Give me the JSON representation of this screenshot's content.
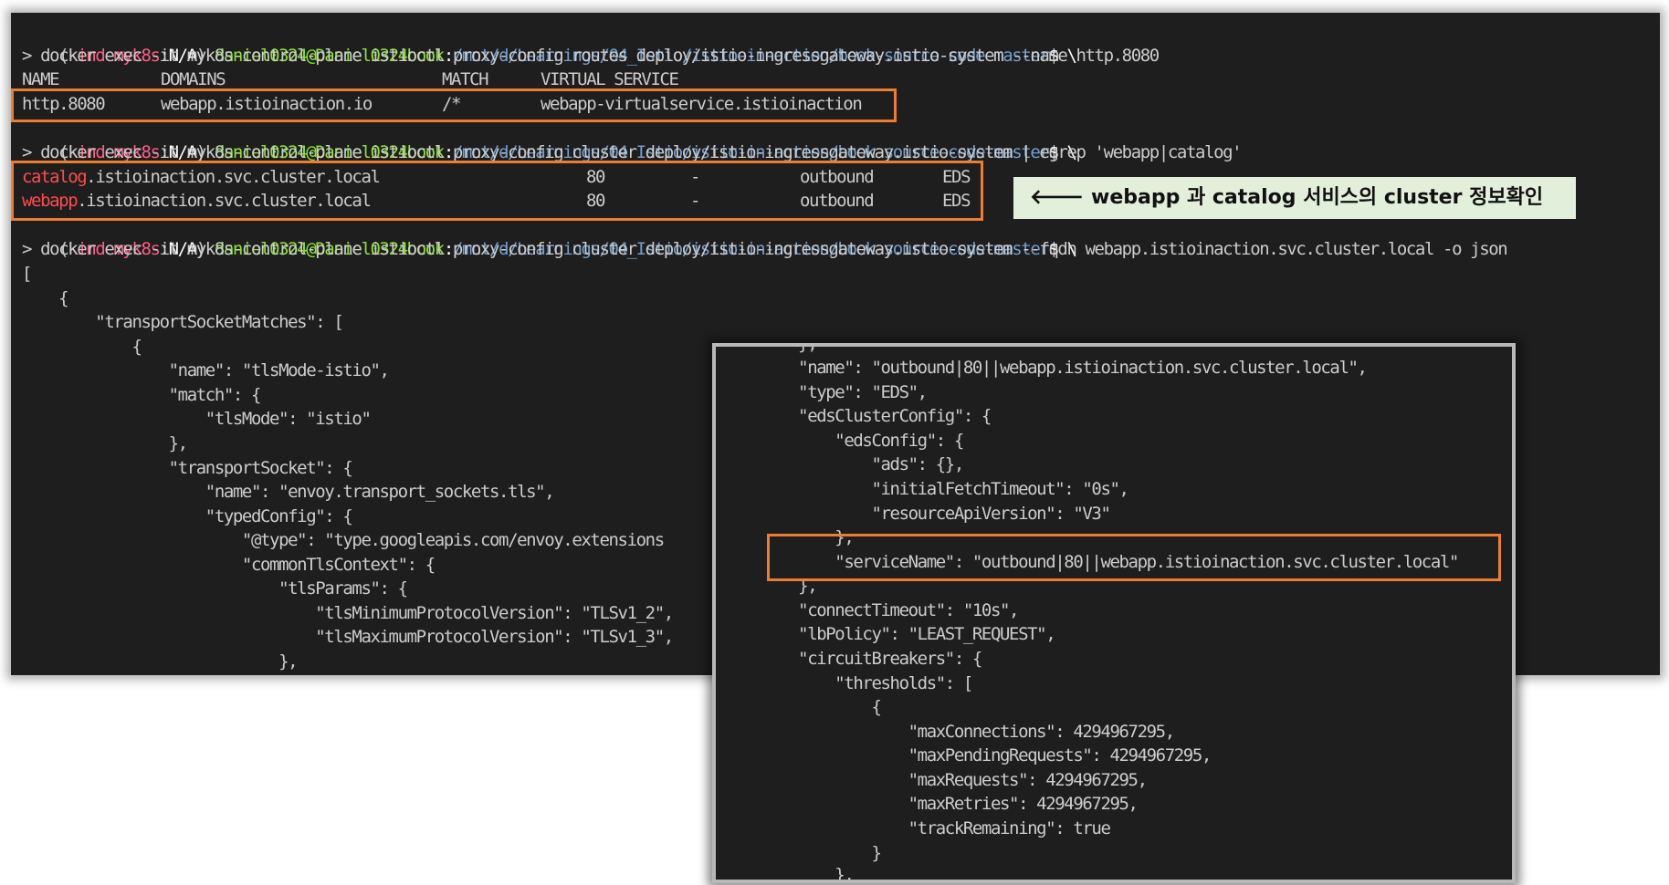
{
  "prompt": {
    "open": "(",
    "ctx_tag": "kind-myk8s",
    "ctx_sep": ":",
    "ctx_ns": "N/A",
    "close": ") ",
    "user": "daniel0324@Daniel0324book",
    "colon": ":",
    "path": "/mnt/d/Learnings/04_Istio/istio-in-action/book-source-code-master",
    "suffix": "$ \\"
  },
  "commands": {
    "routes": "> docker exec -it myk8s-control-plane istioctl proxy-config routes deploy/istio-ingressgateway.istio-system --name http.8080",
    "cluster_grep": "> docker exec -it myk8s-control-plane istioctl proxy-config cluster deploy/istio-ingressgateway.istio-system | egrep 'webapp|catalog'",
    "cluster_json": "> docker exec -it myk8s-control-plane istioctl proxy-config cluster deploy/istio-ingressgateway.istio-system --fqdn webapp.istioinaction.svc.cluster.local -o json"
  },
  "routes_table": {
    "headers": [
      "NAME",
      "DOMAINS",
      "MATCH",
      "VIRTUAL SERVICE"
    ],
    "row": [
      "http.8080",
      "webapp.istioinaction.io",
      "/*",
      "webapp-virtualservice.istioinaction"
    ]
  },
  "clusters": [
    {
      "name_hl": "catalog",
      "name_rest": ".istioinaction.svc.cluster.local",
      "port": "80",
      "subset": "-",
      "direction": "outbound",
      "type": "EDS"
    },
    {
      "name_hl": "webapp",
      "name_rest": ".istioinaction.svc.cluster.local",
      "port": "80",
      "subset": "-",
      "direction": "outbound",
      "type": "EDS"
    }
  ],
  "callout": {
    "arrow": "🡐",
    "text": "webapp 과 catalog 서비스의 cluster 정보확인"
  },
  "json_main": [
    "[",
    "    {",
    "        \"transportSocketMatches\": [",
    "            {",
    "                \"name\": \"tlsMode-istio\",",
    "                \"match\": {",
    "                    \"tlsMode\": \"istio\"",
    "                },",
    "                \"transportSocket\": {",
    "                    \"name\": \"envoy.transport_sockets.tls\",",
    "                    \"typedConfig\": {",
    "                        \"@type\": \"type.googleapis.com/envoy.extensions",
    "                        \"commonTlsContext\": {",
    "                            \"tlsParams\": {",
    "                                \"tlsMinimumProtocolVersion\": \"TLSv1_2\",",
    "                                \"tlsMaximumProtocolVersion\": \"TLSv1_3\",",
    "                            },"
  ],
  "json_inset": [
    "    },",
    "    \"name\": \"outbound|80||webapp.istioinaction.svc.cluster.local\",",
    "    \"type\": \"EDS\",",
    "    \"edsClusterConfig\": {",
    "        \"edsConfig\": {",
    "            \"ads\": {},",
    "            \"initialFetchTimeout\": \"0s\",",
    "            \"resourceApiVersion\": \"V3\"",
    "        },",
    "        \"serviceName\": \"outbound|80||webapp.istioinaction.svc.cluster.local\"",
    "    },",
    "    \"connectTimeout\": \"10s\",",
    "    \"lbPolicy\": \"LEAST_REQUEST\",",
    "    \"circuitBreakers\": {",
    "        \"thresholds\": [",
    "            {",
    "                \"maxConnections\": 4294967295,",
    "                \"maxPendingRequests\": 4294967295,",
    "                \"maxRequests\": 4294967295,",
    "                \"maxRetries\": 4294967295,",
    "                \"trackRemaining\": true",
    "            }",
    "        },"
  ]
}
